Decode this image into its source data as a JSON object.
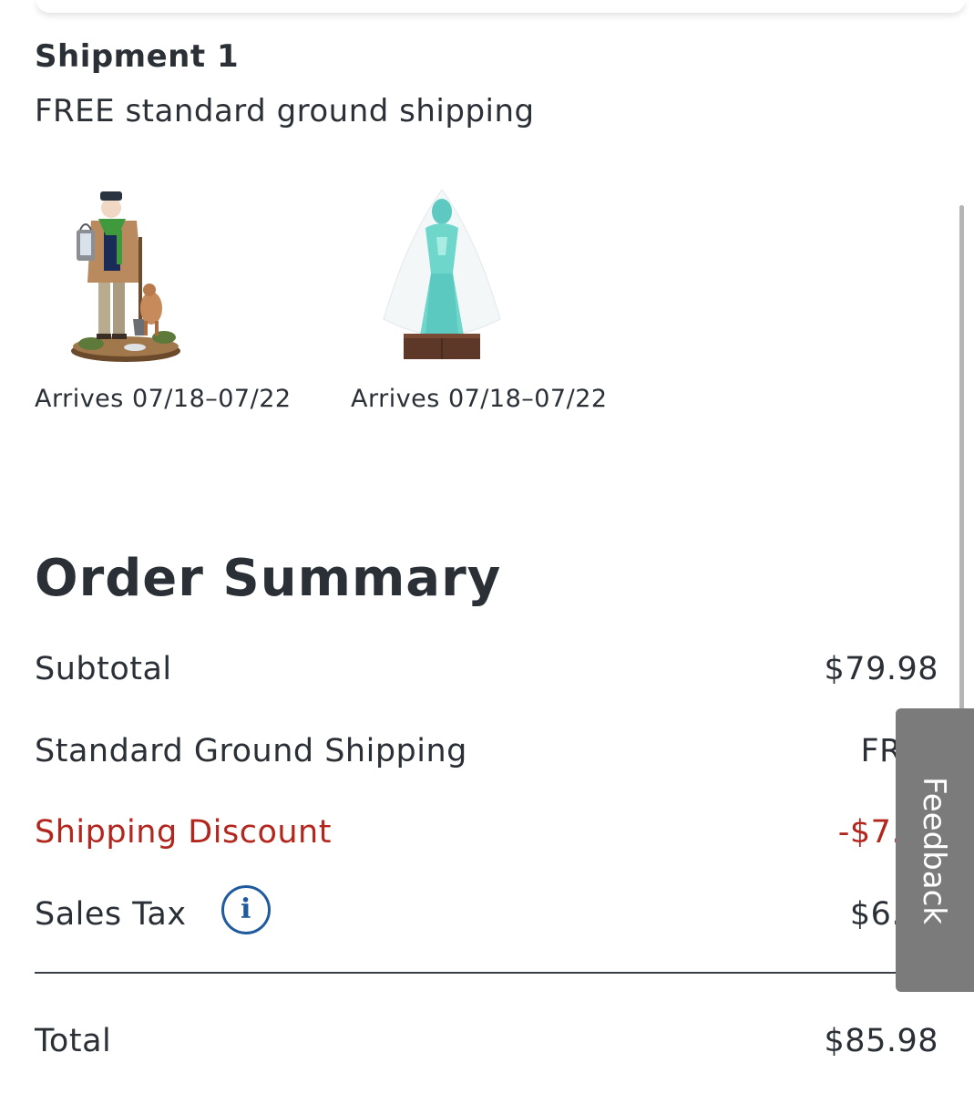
{
  "shipment": {
    "title": "Shipment 1",
    "method": "FREE standard ground shipping",
    "items": [
      {
        "image": "figurine-man-with-lantern-and-dog",
        "arrival": "Arrives 07/18–07/22"
      },
      {
        "image": "figurine-ghost-bride",
        "arrival": "Arrives 07/18–07/22"
      }
    ]
  },
  "order_summary": {
    "title": "Order Summary",
    "subtotal_label": "Subtotal",
    "subtotal_value": "$79.98",
    "shipping_label": "Standard Ground Shipping",
    "shipping_value": "FR",
    "discount_label": "Shipping Discount",
    "discount_value": "-$7.",
    "tax_label": "Sales Tax",
    "tax_info_icon": "info-icon",
    "tax_info_glyph": "i",
    "tax_value": "$6.",
    "total_label": "Total",
    "total_value": "$85.98"
  },
  "feedback": {
    "label": "Feedback"
  },
  "colors": {
    "text": "#2b3037",
    "discount": "#b3261e",
    "info_icon": "#1f5a9e",
    "feedback_tab": "#7b7b7b"
  }
}
